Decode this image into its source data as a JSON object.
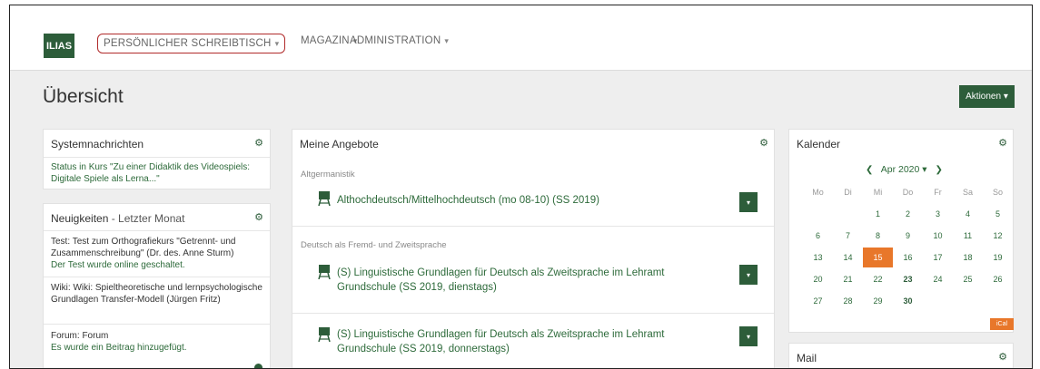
{
  "brand": {
    "logo": "ILIAS"
  },
  "nav": [
    {
      "label": "PERSÖNLICHER SCHREIBTISCH",
      "caret": "▾"
    },
    {
      "label": "MAGAZIN",
      "caret": "▾"
    },
    {
      "label": "ADMINISTRATION",
      "caret": "▾"
    }
  ],
  "page": {
    "title": "Übersicht",
    "actions_label": "Aktionen ▾"
  },
  "systemnachrichten": {
    "title": "Systemnachrichten",
    "message": "Status in Kurs \"Zu einer Didaktik des Videospiels: Digitale Spiele als Lerna...\""
  },
  "neuigkeiten": {
    "title": "Neuigkeiten",
    "subtitle": " - Letzter Monat",
    "items": [
      {
        "text": "Test: Test zum Orthografiekurs \"Getrennt- und Zusammenschreibung\" (Dr. des. Anne Sturm)",
        "link": "Der Test wurde online geschaltet."
      },
      {
        "text": "Wiki: Wiki: Spieltheoretische und lernpsychologische Grundlagen Transfer-Modell (Jürgen Fritz)",
        "link": ""
      },
      {
        "text": "Forum: Forum",
        "link": "Es wurde ein Beitrag hinzugefügt."
      }
    ]
  },
  "angebote": {
    "title": "Meine Angebote",
    "groups": [
      {
        "category": "Altgermanistik",
        "items": [
          "Althochdeutsch/Mittelhochdeutsch (mo 08-10) (SS 2019)"
        ]
      },
      {
        "category": "Deutsch als Fremd- und Zweitsprache",
        "items": [
          "(S) Linguistische Grundlagen für Deutsch als Zweitsprache im Lehramt Grundschule (SS 2019, dienstags)",
          "(S) Linguistische Grundlagen für Deutsch als Zweitsprache im Lehramt Grundschule (SS 2019, donnerstags)"
        ]
      }
    ],
    "dropdown_label": "▾"
  },
  "kalender": {
    "title": "Kalender",
    "prev": "❮",
    "month": "Apr 2020 ▾",
    "next": "❯",
    "weekdays": [
      "Mo",
      "Di",
      "Mi",
      "Do",
      "Fr",
      "Sa",
      "So"
    ],
    "weeks": [
      [
        "",
        "",
        "1",
        "2",
        "3",
        "4",
        "5"
      ],
      [
        "6",
        "7",
        "8",
        "9",
        "10",
        "11",
        "12"
      ],
      [
        "13",
        "14",
        "15",
        "16",
        "17",
        "18",
        "19"
      ],
      [
        "20",
        "21",
        "22",
        "23",
        "24",
        "25",
        "26"
      ],
      [
        "27",
        "28",
        "29",
        "30",
        "",
        "",
        ""
      ]
    ],
    "today": "15",
    "bold_days": [
      "23",
      "30"
    ],
    "ical_label": "iCal"
  },
  "mail": {
    "title": "Mail"
  },
  "colors": {
    "brand": "#2d5d3a",
    "link": "#2d6a3a",
    "accent": "#e8772a",
    "highlight_border": "#b02a2a"
  },
  "icons": [
    "gear-icon",
    "chalkboard-icon",
    "chevron-left-icon",
    "chevron-right-icon"
  ]
}
